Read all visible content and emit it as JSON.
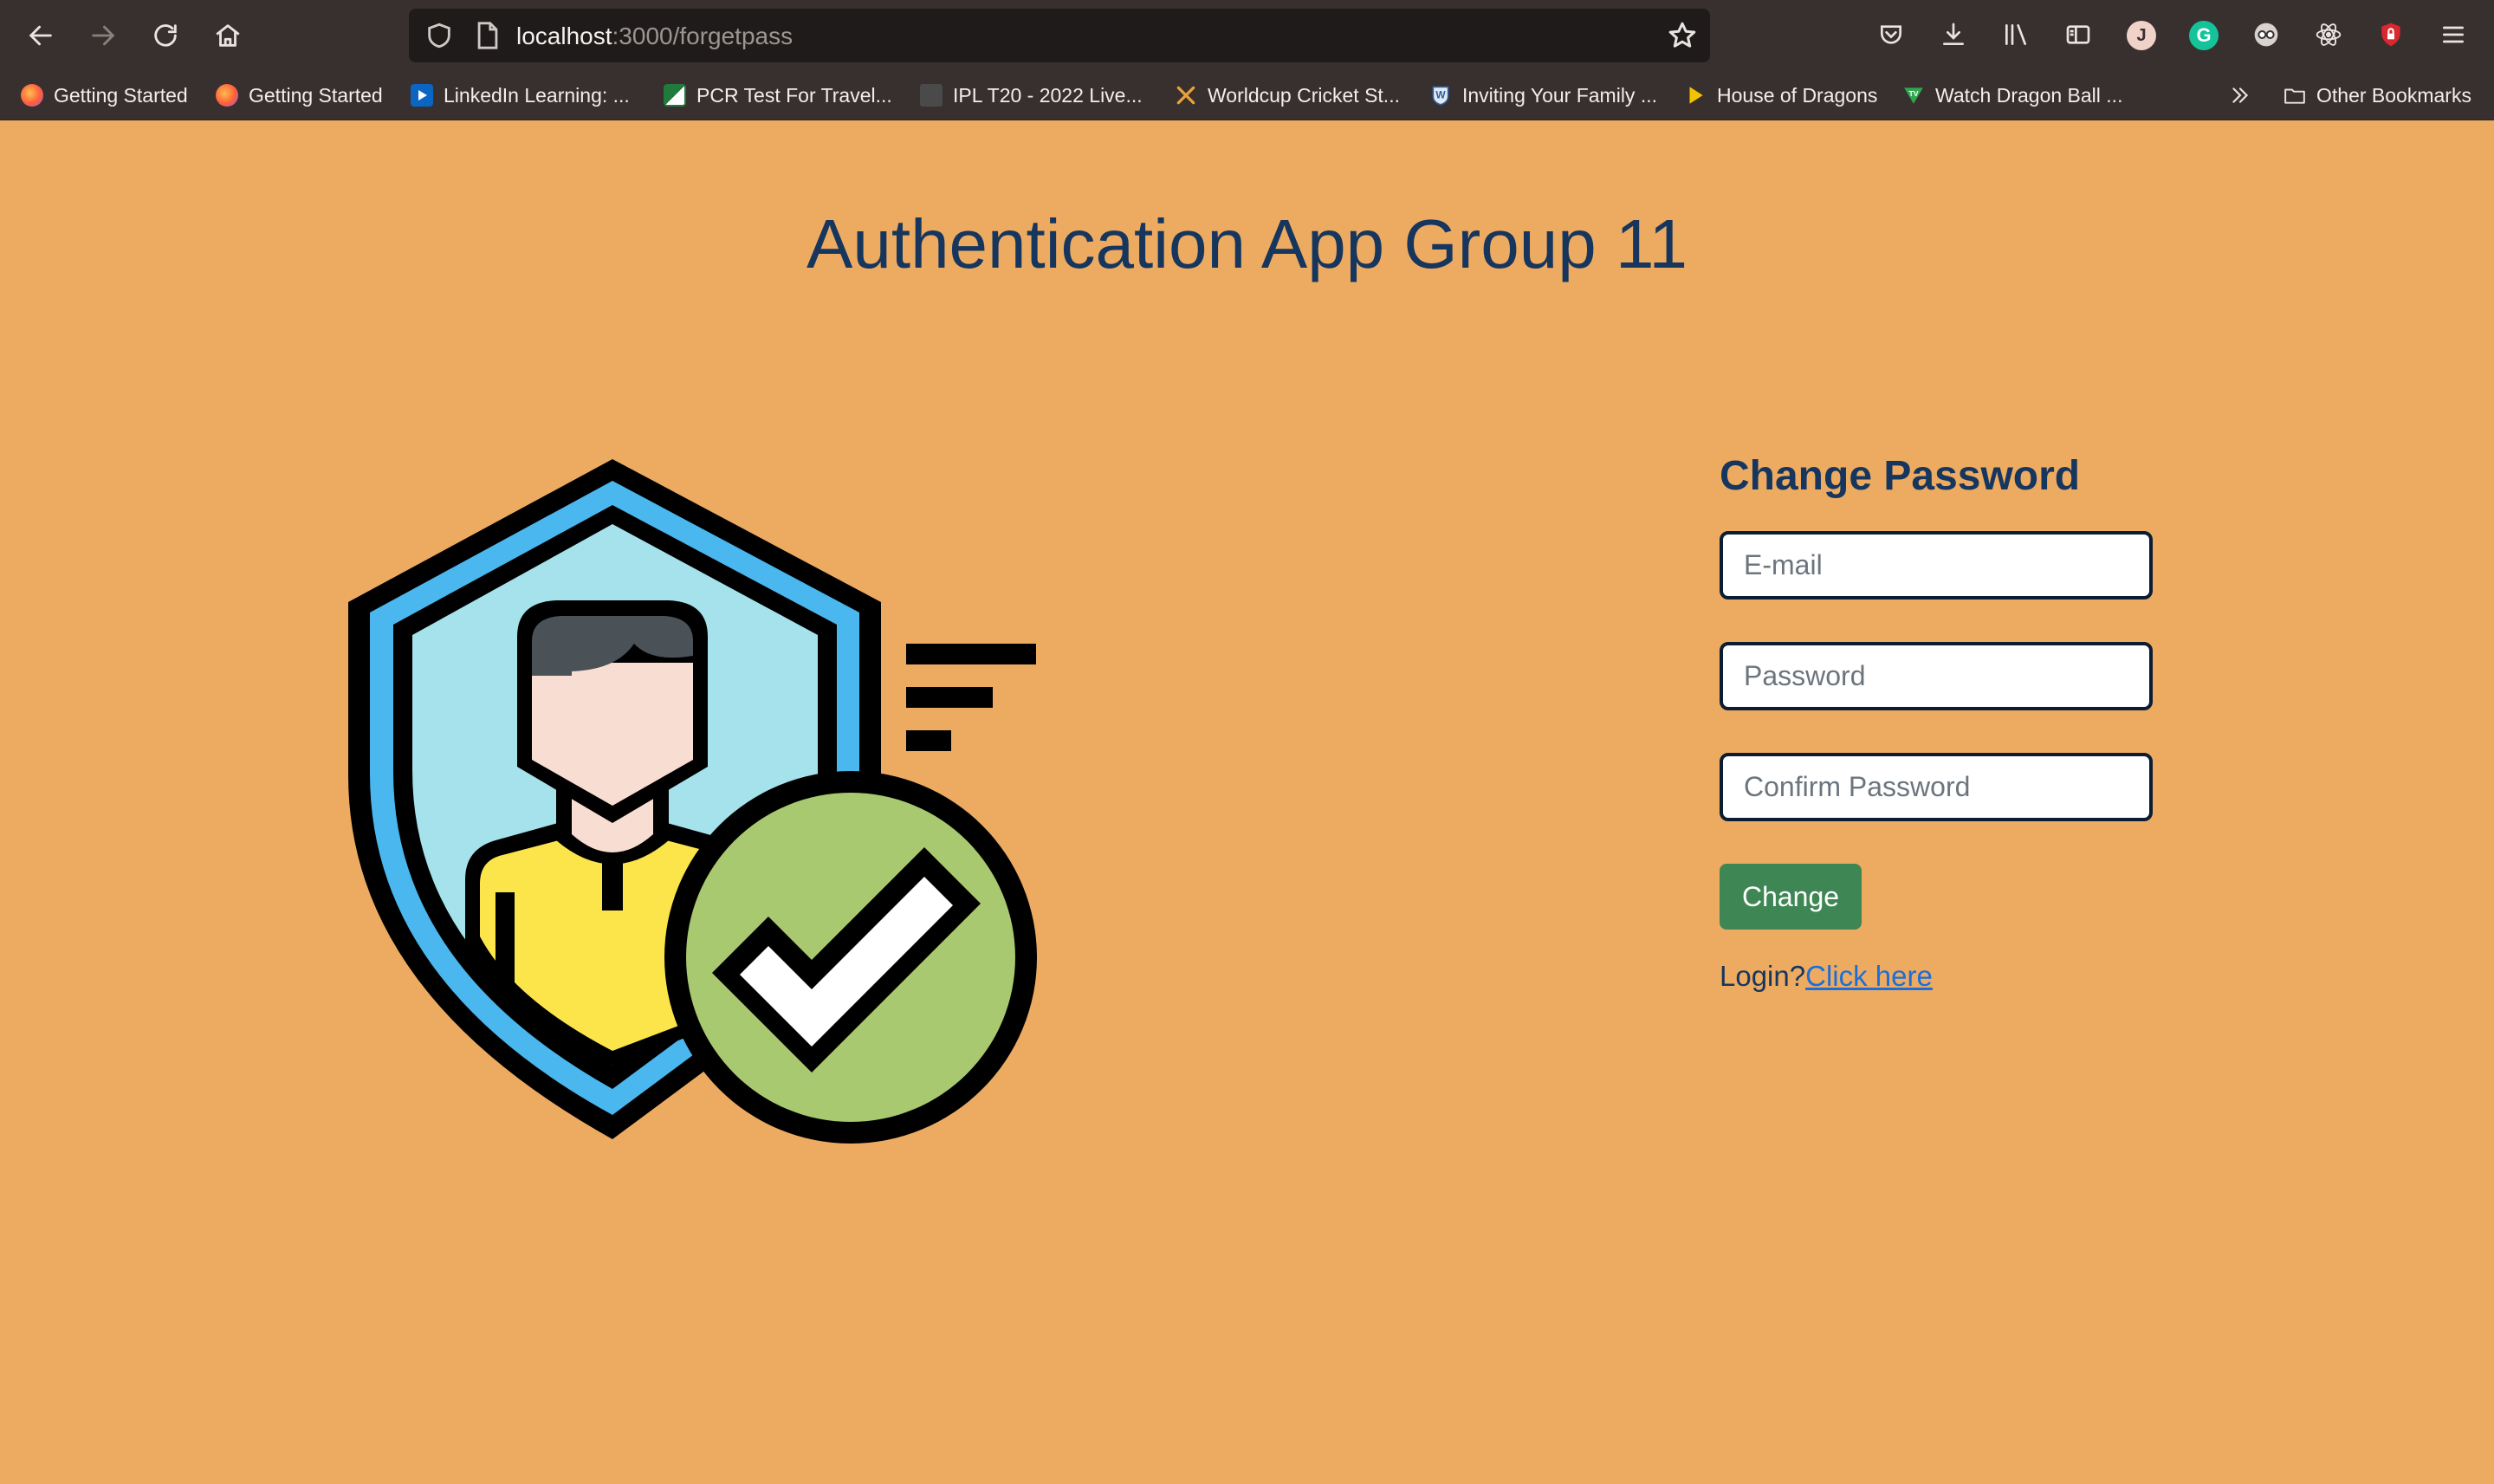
{
  "browser": {
    "url_host": "localhost",
    "url_path": ":3000/forgetpass",
    "profile_initial": "J",
    "grammarly_initial": "G",
    "bookmarks": [
      {
        "label": "Getting Started",
        "icon": "firefox-icon",
        "color": "#e66000"
      },
      {
        "label": "Getting Started",
        "icon": "firefox-icon",
        "color": "#e66000"
      },
      {
        "label": "LinkedIn Learning: ...",
        "icon": "linkedin-learning-icon",
        "color": "#0a66c2"
      },
      {
        "label": "PCR Test For Travel...",
        "icon": "pcr-site-icon",
        "color": "#1f7a3c"
      },
      {
        "label": "IPL T20 - 2022 Live...",
        "icon": "tv-icon",
        "color": "#4a4a4a"
      },
      {
        "label": "Worldcup Cricket St...",
        "icon": "crossed-bats-icon",
        "color": "#e8a23a"
      },
      {
        "label": "Inviting Your Family ...",
        "icon": "wp-icon",
        "color": "#2c5e9e"
      },
      {
        "label": "House of Dragons",
        "icon": "play-icon",
        "color": "#f2c400"
      },
      {
        "label": "Watch Dragon Ball ...",
        "icon": "tv-badge-icon",
        "color": "#2fa84f"
      }
    ],
    "other_bookmarks": "Other Bookmarks"
  },
  "page": {
    "title": "Authentication App Group 11",
    "form": {
      "heading": "Change Password",
      "email_placeholder": "E-mail",
      "password_placeholder": "Password",
      "confirm_placeholder": "Confirm Password",
      "submit_label": "Change",
      "login_prompt": "Login?",
      "login_link": "Click here"
    }
  },
  "colors": {
    "page_background": "#EDAB62",
    "title": "#16365e",
    "button": "#3e8754",
    "link": "#1c6ed8"
  }
}
